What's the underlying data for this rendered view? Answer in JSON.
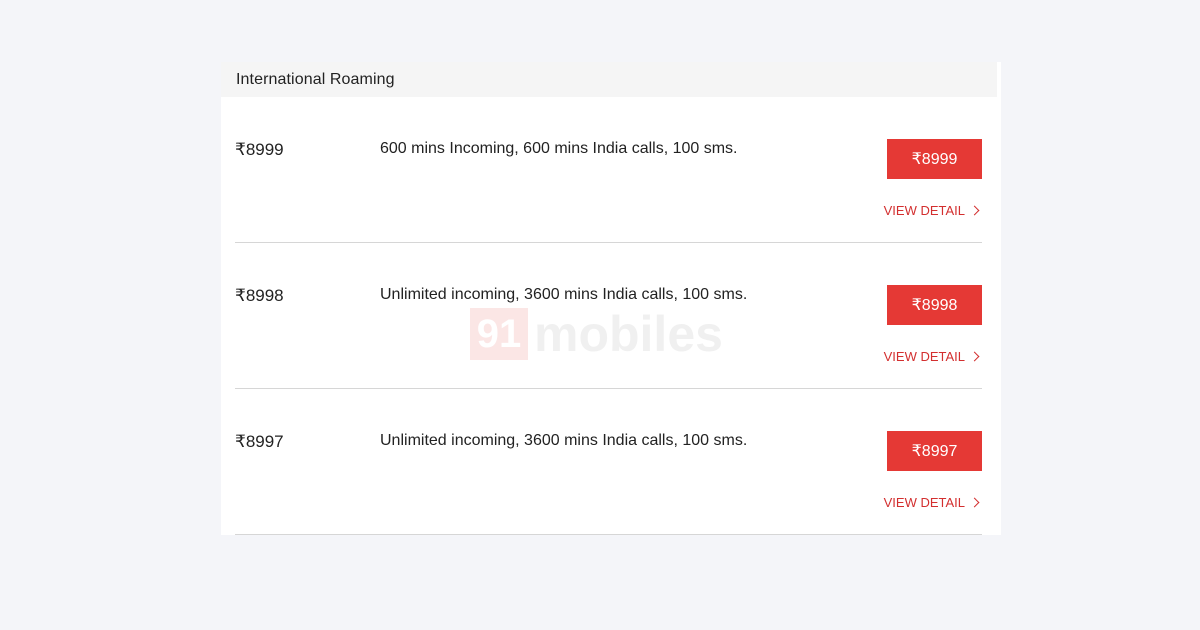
{
  "section": {
    "title": "International Roaming"
  },
  "plans": [
    {
      "price": "₹8999",
      "description": "600 mins Incoming, 600 mins India calls, 100 sms.",
      "button_label": "₹8999",
      "detail_label": "VIEW DETAIL"
    },
    {
      "price": "₹8998",
      "description": "Unlimited incoming, 3600 mins India calls, 100 sms.",
      "button_label": "₹8998",
      "detail_label": "VIEW DETAIL"
    },
    {
      "price": "₹8997",
      "description": "Unlimited incoming, 3600 mins India calls, 100 sms.",
      "button_label": "₹8997",
      "detail_label": "VIEW DETAIL"
    }
  ],
  "watermark": {
    "number": "91",
    "text": "mobiles"
  },
  "colors": {
    "accent": "#e53935",
    "link": "#d32f2f",
    "background": "#f4f5f9"
  },
  "icons": {
    "detail_arrow": "chevron-right-icon"
  }
}
